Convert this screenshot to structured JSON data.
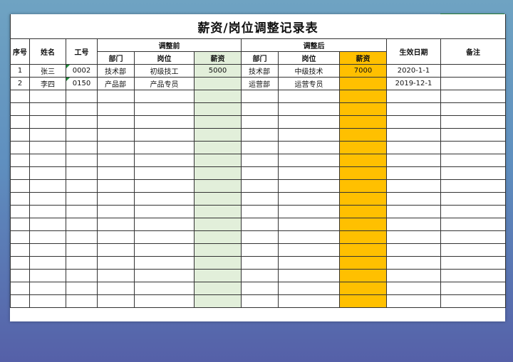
{
  "title": "薪资/岗位调整记录表",
  "headers": {
    "seq": "序号",
    "name": "姓名",
    "emp_no": "工号",
    "before_group": "调整前",
    "after_group": "调整后",
    "dept": "部门",
    "position": "岗位",
    "salary": "薪资",
    "effective_date": "生效日期",
    "remarks": "备注"
  },
  "rows": [
    {
      "seq": "1",
      "name": "张三",
      "emp_no": "0002",
      "before_dept": "技术部",
      "before_position": "初级技工",
      "before_salary": "5000",
      "after_dept": "技术部",
      "after_position": "中级技术",
      "after_salary": "7000",
      "effective_date": "2020-1-1",
      "remarks": ""
    },
    {
      "seq": "2",
      "name": "李四",
      "emp_no": "0150",
      "before_dept": "产品部",
      "before_position": "产品专员",
      "before_salary": "",
      "after_dept": "运营部",
      "after_position": "运营专员",
      "after_salary": "",
      "effective_date": "2019-12-1",
      "remarks": ""
    }
  ],
  "colors": {
    "before_salary_fill": "#e2efda",
    "after_salary_fill": "#ffc000",
    "cell_marker": "#1e8b3a"
  }
}
